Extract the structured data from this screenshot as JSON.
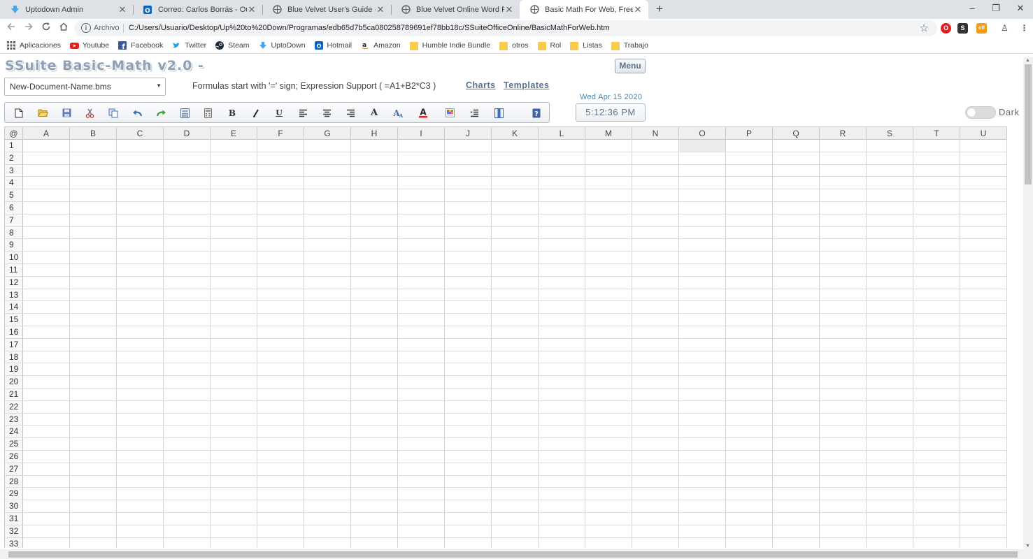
{
  "browser": {
    "tabs": [
      {
        "title": "Uptodown Admin",
        "icon": "uptodown-icon",
        "active": false
      },
      {
        "title": "Correo: Carlos Borrás - Outlook",
        "icon": "outlook-icon",
        "active": false
      },
      {
        "title": "Blue Velvet User's Guide - SSuite",
        "icon": "globe-icon",
        "active": false
      },
      {
        "title": "Blue Velvet Online Word Processor",
        "icon": "globe-icon",
        "active": false
      },
      {
        "title": "Basic Math For Web, Free Online",
        "icon": "globe-icon",
        "active": true
      }
    ],
    "new_tab": "+",
    "window_controls": {
      "minimize": "–",
      "restore": "❐",
      "close": "✕"
    },
    "address": {
      "protocol_label": "Archivo",
      "url": "C:/Users/Usuario/Desktop/Up%20to%20Down/Programas/edb65d7b5ca080258789691ef78bb18c/SSuiteOfficeOnline/BasicMathForWeb.htm"
    },
    "bookmarks": [
      {
        "label": "Aplicaciones",
        "icon": "apps-grid-icon"
      },
      {
        "label": "Youtube",
        "icon": "youtube-icon"
      },
      {
        "label": "Facebook",
        "icon": "facebook-icon"
      },
      {
        "label": "Twitter",
        "icon": "twitter-icon"
      },
      {
        "label": "Steam",
        "icon": "steam-icon"
      },
      {
        "label": "UptoDown",
        "icon": "uptodown-icon"
      },
      {
        "label": "Hotmail",
        "icon": "outlook-icon"
      },
      {
        "label": "Amazon",
        "icon": "amazon-icon"
      },
      {
        "label": "Humble Indie Bundle",
        "icon": "folder-icon"
      },
      {
        "label": "otros",
        "icon": "folder-icon"
      },
      {
        "label": "Rol",
        "icon": "folder-icon"
      },
      {
        "label": "Listas",
        "icon": "folder-icon"
      },
      {
        "label": "Trabajo",
        "icon": "folder-icon"
      }
    ],
    "extension_badge": "off"
  },
  "app": {
    "title": "SSuite Basic-Math v2.0 -",
    "menu_label": "Menu",
    "document_name": "New-Document-Name.bms",
    "hint": "Formulas start with '=' sign; Expression Support ( =A1+B2*C3 )",
    "links": {
      "charts": "Charts",
      "templates": "Templates"
    },
    "date": "Wed Apr 15 2020",
    "time": "5:12:36 PM",
    "dark_label": "Dark",
    "dark_mode": false,
    "toolbar": [
      "new-document-icon",
      "open-folder-icon",
      "save-icon",
      "cut-icon",
      "copy-icon",
      "undo-icon",
      "redo-icon",
      "calculator-icon",
      "sum-icon",
      "bold-icon",
      "italic-icon",
      "underline-icon",
      "align-left-icon",
      "align-center-icon",
      "align-right-icon",
      "font-icon",
      "font-size-icon",
      "font-color-icon",
      "cell-color-icon",
      "indent-icon",
      "column-icon",
      "help-icon"
    ],
    "toolbar_glyphs": {
      "bold": "B",
      "italic": "I",
      "underline": "U",
      "font": "A",
      "help": "?"
    }
  },
  "grid": {
    "corner": "@",
    "columns": [
      "A",
      "B",
      "C",
      "D",
      "E",
      "F",
      "G",
      "H",
      "I",
      "J",
      "K",
      "L",
      "M",
      "N",
      "O",
      "P",
      "Q",
      "R",
      "S",
      "T",
      "U"
    ],
    "rows": [
      1,
      2,
      3,
      4,
      5,
      6,
      7,
      8,
      9,
      10,
      11,
      12,
      13,
      14,
      15,
      16,
      17,
      18,
      19,
      20,
      21,
      22,
      23,
      24,
      25,
      26,
      27,
      28,
      29,
      30,
      31,
      32,
      33
    ],
    "selected_cell": "O1"
  }
}
